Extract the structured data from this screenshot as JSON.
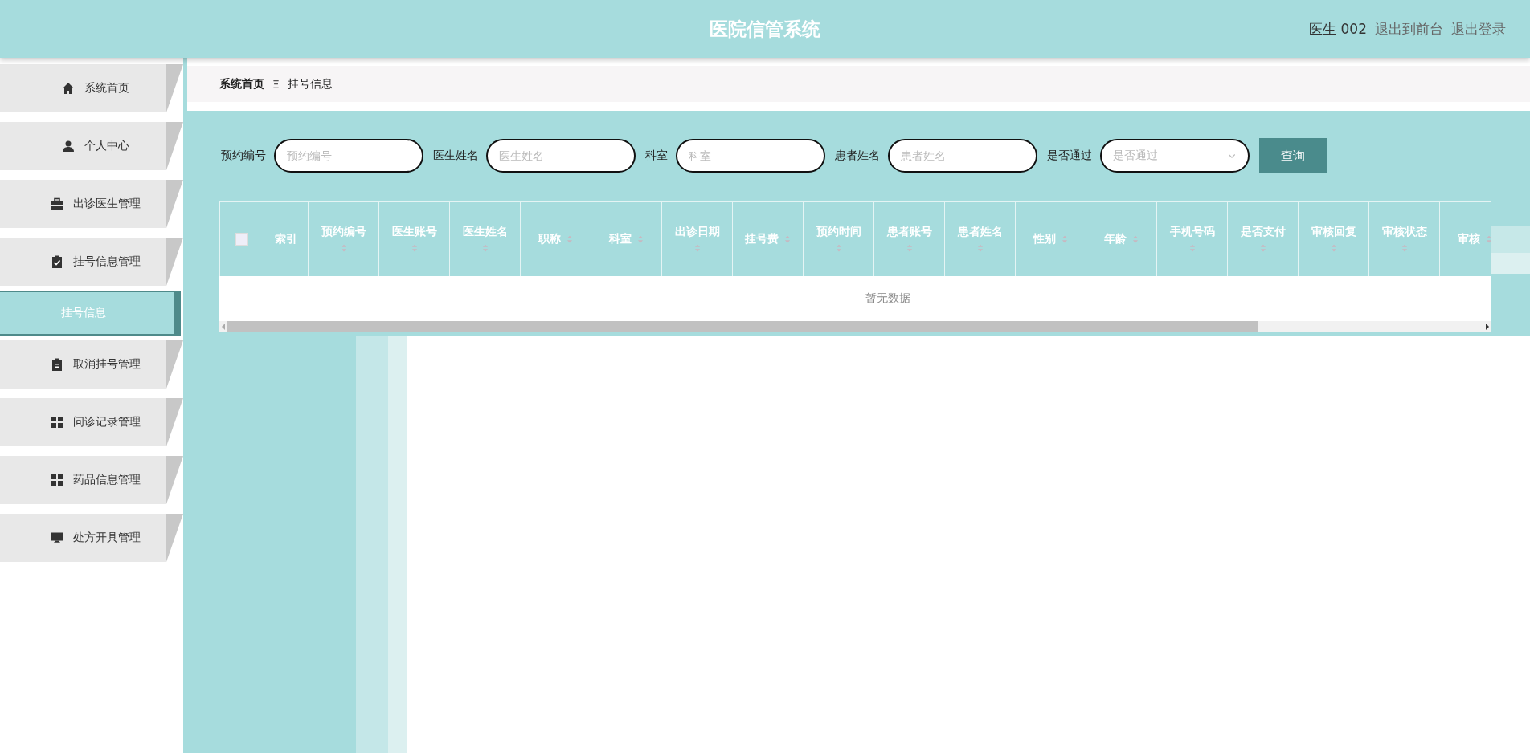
{
  "header": {
    "title": "医院信管系统",
    "user": "医生 002",
    "links": [
      "退出到前台",
      "退出登录"
    ]
  },
  "sidebar": {
    "items": [
      {
        "label": "系统首页",
        "kind": "menu",
        "selected": false
      },
      {
        "label": "个人中心",
        "kind": "menu",
        "selected": false
      },
      {
        "label": "出诊医生管理",
        "kind": "menu",
        "selected": false
      },
      {
        "label": "挂号信息管理",
        "kind": "menu",
        "selected": false
      },
      {
        "label": "挂号信息",
        "kind": "submenu",
        "selected": true
      },
      {
        "label": "取消挂号管理",
        "kind": "menu",
        "selected": false
      },
      {
        "label": "问诊记录管理",
        "kind": "menu",
        "selected": false
      },
      {
        "label": "药品信息管理",
        "kind": "menu",
        "selected": false
      },
      {
        "label": "处方开具管理",
        "kind": "menu",
        "selected": false
      }
    ]
  },
  "breadcrumb": {
    "items": [
      "系统首页",
      "挂号信息"
    ],
    "separator": "Ξ"
  },
  "search": {
    "fields": [
      {
        "label": "预约编号",
        "placeholder": "预约编号",
        "kind": "input"
      },
      {
        "label": "医生姓名",
        "placeholder": "医生姓名",
        "kind": "input"
      },
      {
        "label": "科室",
        "placeholder": "科室",
        "kind": "input"
      },
      {
        "label": "患者姓名",
        "placeholder": "患者姓名",
        "kind": "input"
      },
      {
        "label": "是否通过",
        "placeholder": "是否通过",
        "kind": "select"
      }
    ],
    "button": "查询"
  },
  "table": {
    "select_all": {
      "checked": false
    },
    "columns": [
      {
        "label": "索引",
        "sortable": false
      },
      {
        "label": "预约编号",
        "sortable": true
      },
      {
        "label": "医生账号",
        "sortable": true
      },
      {
        "label": "医生姓名",
        "sortable": true
      },
      {
        "label": "职称",
        "sortable": true
      },
      {
        "label": "科室",
        "sortable": true
      },
      {
        "label": "出诊日期",
        "sortable": true
      },
      {
        "label": "挂号费",
        "sortable": true
      },
      {
        "label": "预约时间",
        "sortable": true
      },
      {
        "label": "患者账号",
        "sortable": true
      },
      {
        "label": "患者姓名",
        "sortable": true
      },
      {
        "label": "性别",
        "sortable": true
      },
      {
        "label": "年龄",
        "sortable": true
      },
      {
        "label": "手机号码",
        "sortable": true
      },
      {
        "label": "是否支付",
        "sortable": true
      },
      {
        "label": "审核回复",
        "sortable": true
      },
      {
        "label": "审核状态",
        "sortable": true
      },
      {
        "label": "审核",
        "sortable": true
      }
    ],
    "empty_text": "暂无数据"
  }
}
